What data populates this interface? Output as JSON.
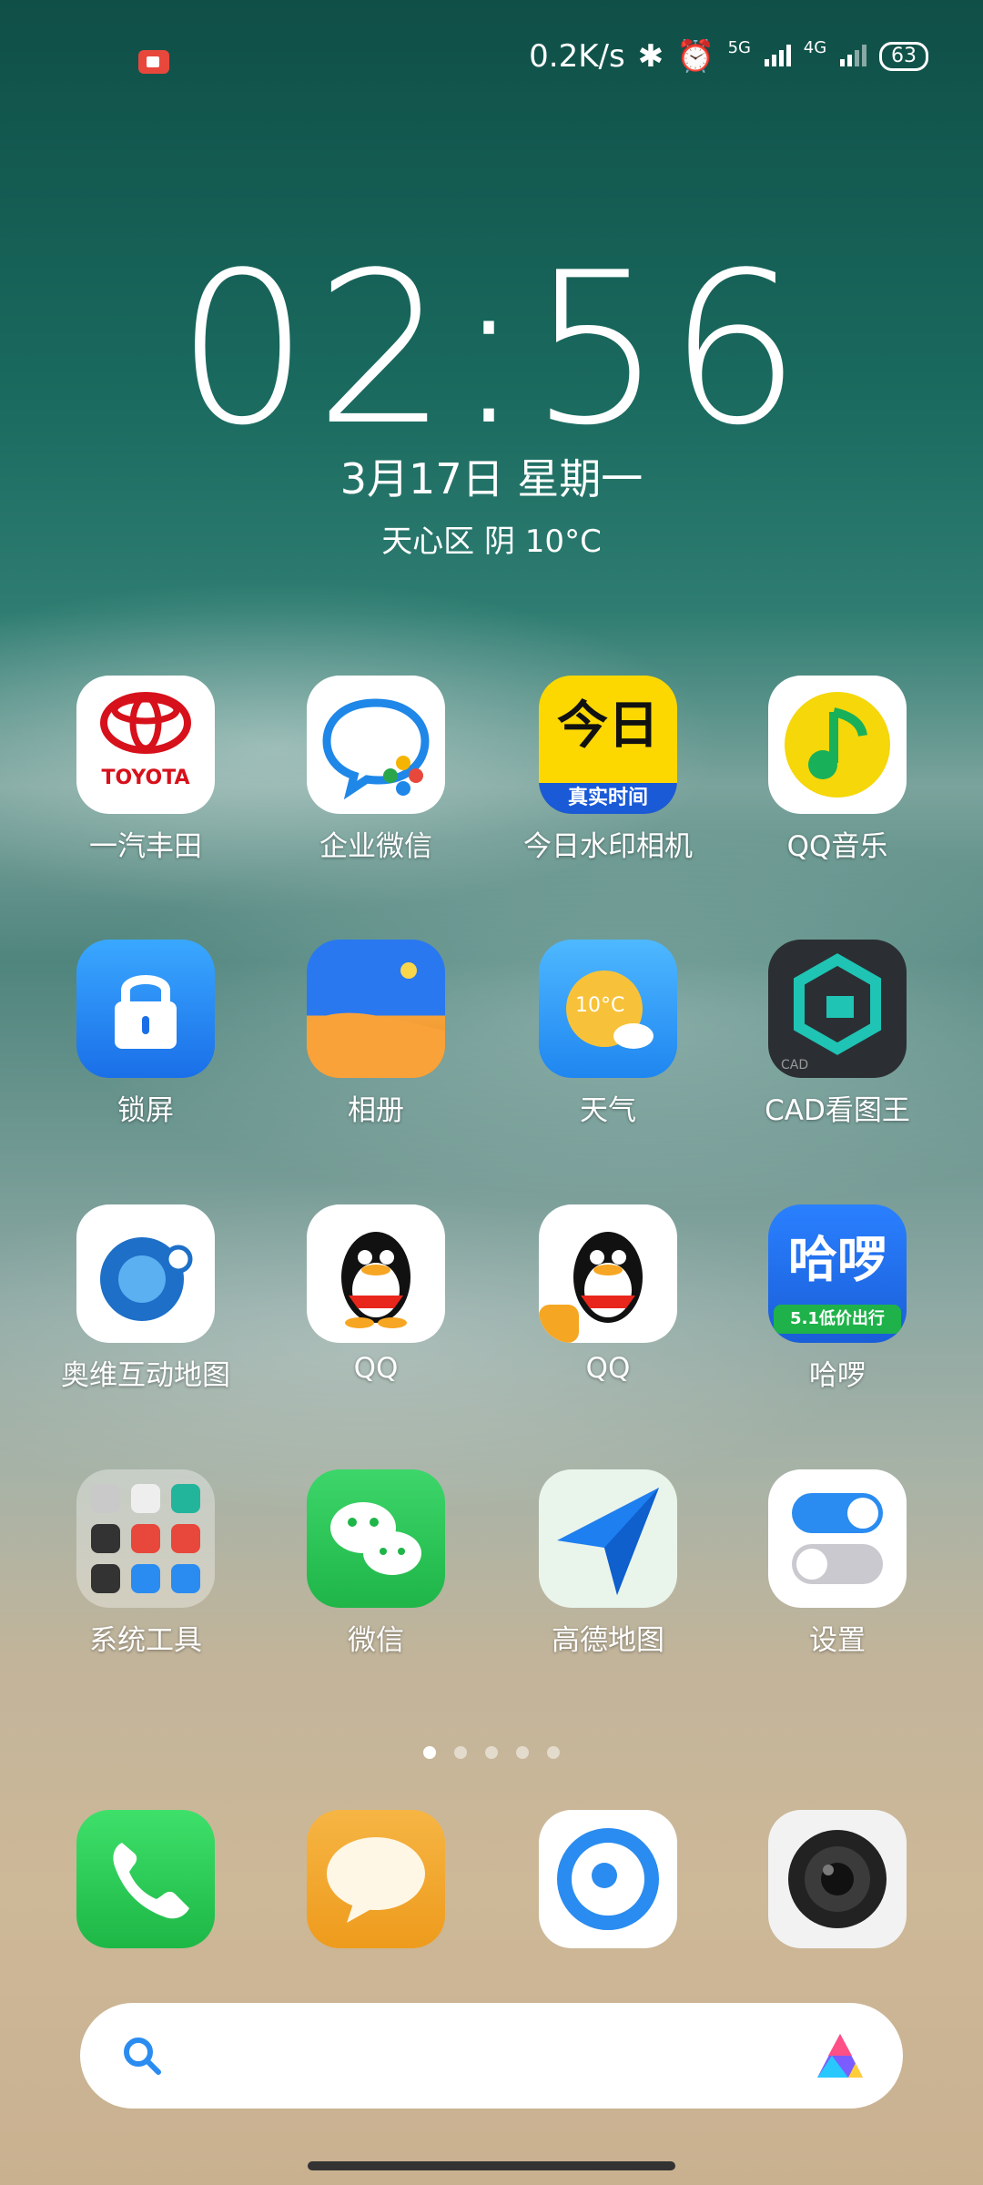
{
  "status_bar": {
    "net_speed": "0.2K/s",
    "sim1": "5G",
    "sim2": "4G",
    "battery": "63"
  },
  "lock": {
    "time": "02:56",
    "date": "3月17日  星期一",
    "weather": "天心区 阴 10°C"
  },
  "apps": [
    {
      "label": "一汽丰田",
      "icon": "toyota-icon"
    },
    {
      "label": "企业微信",
      "icon": "wecom-icon"
    },
    {
      "label": "今日水印相机",
      "icon": "watermark-camera-icon"
    },
    {
      "label": "QQ音乐",
      "icon": "qq-music-icon"
    },
    {
      "label": "锁屏",
      "icon": "lock-icon"
    },
    {
      "label": "相册",
      "icon": "gallery-icon"
    },
    {
      "label": "天气",
      "icon": "weather-icon"
    },
    {
      "label": "CAD看图王",
      "icon": "cad-icon"
    },
    {
      "label": "奥维互动地图",
      "icon": "ovital-map-icon"
    },
    {
      "label": "QQ",
      "icon": "qq-icon"
    },
    {
      "label": "QQ",
      "icon": "qq-clone-icon"
    },
    {
      "label": "哈啰",
      "icon": "hellobike-icon"
    },
    {
      "label": "系统工具",
      "icon": "system-tools-folder-icon"
    },
    {
      "label": "微信",
      "icon": "wechat-icon"
    },
    {
      "label": "高德地图",
      "icon": "amap-icon"
    },
    {
      "label": "设置",
      "icon": "settings-icon"
    }
  ],
  "icon_text": {
    "toyota": "TOYOTA",
    "watermark_top": "今日",
    "watermark_bottom": "真实时间",
    "weather_temp": "10°C",
    "cad": "CAD",
    "hellobike_top": "哈啰",
    "hellobike_bottom": "5.1低价出行"
  },
  "dock": [
    {
      "icon": "phone-icon"
    },
    {
      "icon": "messages-icon"
    },
    {
      "icon": "browser-icon"
    },
    {
      "icon": "camera-icon"
    }
  ],
  "page_indicator": {
    "count": 5,
    "active": 1
  },
  "colors": {
    "accent": "#2a8cf0"
  }
}
